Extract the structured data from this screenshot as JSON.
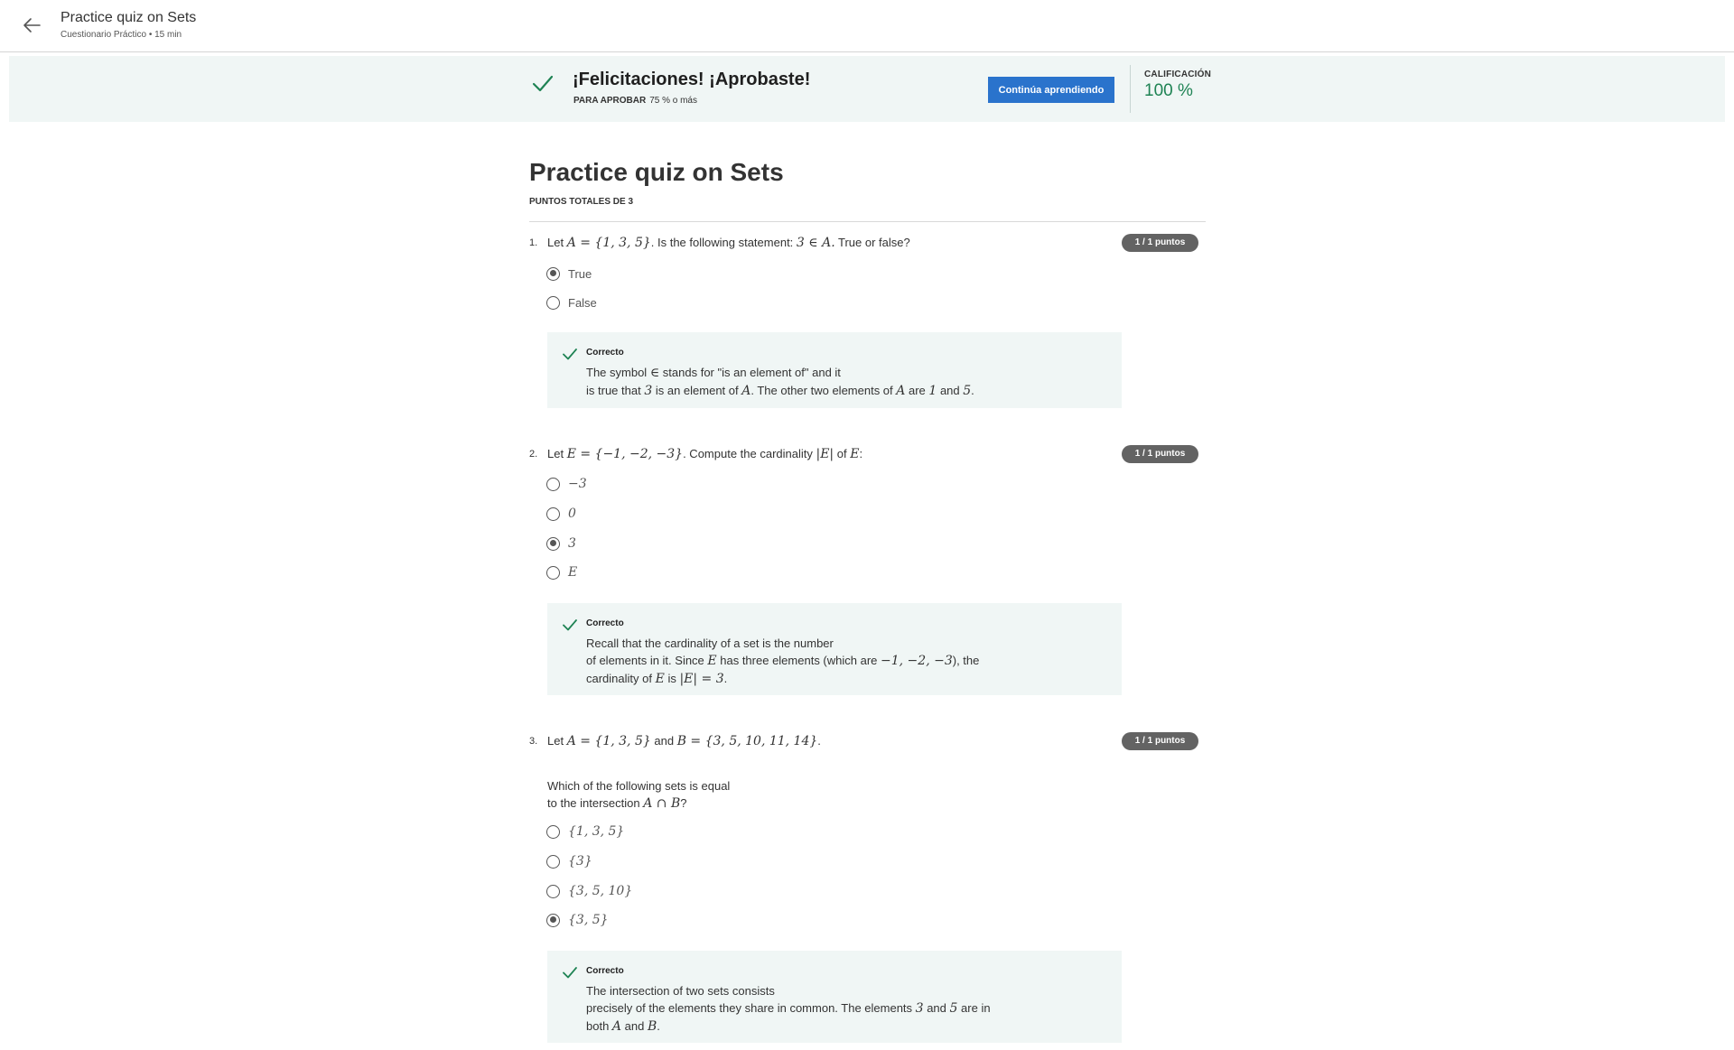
{
  "header": {
    "title": "Practice quiz on Sets",
    "subtitle": "Cuestionario Práctico • 15 min"
  },
  "banner": {
    "title": "¡Felicitaciones! ¡Aprobaste!",
    "pass_label": "PARA APROBAR",
    "pass_value": "75 % o más",
    "continue_label": "Continúa aprendiendo",
    "grade_label": "CALIFICACIÓN",
    "grade_value": "100 %"
  },
  "quiz": {
    "title": "Practice quiz on Sets",
    "points": "PUNTOS TOTALES DE 3"
  },
  "questions": [
    {
      "num": "1.",
      "badge": "1 / 1 puntos",
      "text": {
        "p1": "Let ",
        "m1": "A = {1, 3, 5}",
        "p2": ". Is the following statement: ",
        "m2": "3 ∈ A.",
        "p3": " True or false?"
      },
      "options": [
        {
          "label": "True",
          "selected": true
        },
        {
          "label": "False",
          "selected": false
        }
      ],
      "feedback": {
        "title": "Correcto",
        "l1a": "The symbol ",
        "l1m": "∈",
        "l1b": " stands for \"is an element of\" and it",
        "l2a": "is true that ",
        "l2m1": "3",
        "l2b": " is an element of ",
        "l2m2": "A",
        "l2c": ". The other two elements of ",
        "l2m3": "A",
        "l2d": " are ",
        "l2m4": "1",
        "l2e": " and ",
        "l2m5": "5",
        "l2f": "."
      }
    },
    {
      "num": "2.",
      "badge": "1 / 1 puntos",
      "text": {
        "p1": "Let ",
        "m1": "E = {−1, −2, −3}",
        "p2": ". Compute the cardinality ",
        "m2": "|E|",
        "p3": " of ",
        "m3": "E",
        "p4": ":"
      },
      "options": [
        {
          "label": "−3",
          "selected": false
        },
        {
          "label": "0",
          "selected": false
        },
        {
          "label": "3",
          "selected": true
        },
        {
          "label": "E",
          "selected": false
        }
      ],
      "feedback": {
        "title": "Correcto",
        "l1": "Recall that the cardinality of a set is the number",
        "l2a": "of elements in it. Since ",
        "l2m1": "E",
        "l2b": " has three elements (which are ",
        "l2m2": "−1, −2, −3",
        "l2c": "), the",
        "l3a": "cardinality of ",
        "l3m1": "E",
        "l3b": " is ",
        "l3m2": "|E| = 3",
        "l3c": "."
      }
    },
    {
      "num": "3.",
      "badge": "1 / 1 puntos",
      "text": {
        "p1": "Let ",
        "m1": "A = {1, 3, 5}",
        "p2": " and ",
        "m2": "B = {3, 5, 10, 11, 14}",
        "p3": "."
      },
      "prompt": {
        "l1": "Which of the following sets is equal",
        "l2a": "to the intersection ",
        "l2m": "A ∩ B",
        "l2b": "?"
      },
      "options": [
        {
          "label": "{1, 3, 5}",
          "selected": false
        },
        {
          "label": "{3}",
          "selected": false
        },
        {
          "label": "{3, 5, 10}",
          "selected": false
        },
        {
          "label": "{3, 5}",
          "selected": true
        }
      ],
      "feedback": {
        "title": "Correcto",
        "l1": "The intersection of two sets consists",
        "l2a": "precisely of the elements they share in common. The elements ",
        "l2m1": "3",
        "l2b": " and ",
        "l2m2": "5",
        "l2c": " are in",
        "l3a": "both ",
        "l3m1": "A",
        "l3b": " and ",
        "l3m2": "B",
        "l3c": "."
      }
    }
  ],
  "colors": {
    "accent": "#2a73cc",
    "success": "#1f8354",
    "banner_bg": "#f0f6f5",
    "badge_bg": "#636363"
  },
  "icons": {
    "back": "arrow-left-icon",
    "check": "check-icon"
  }
}
